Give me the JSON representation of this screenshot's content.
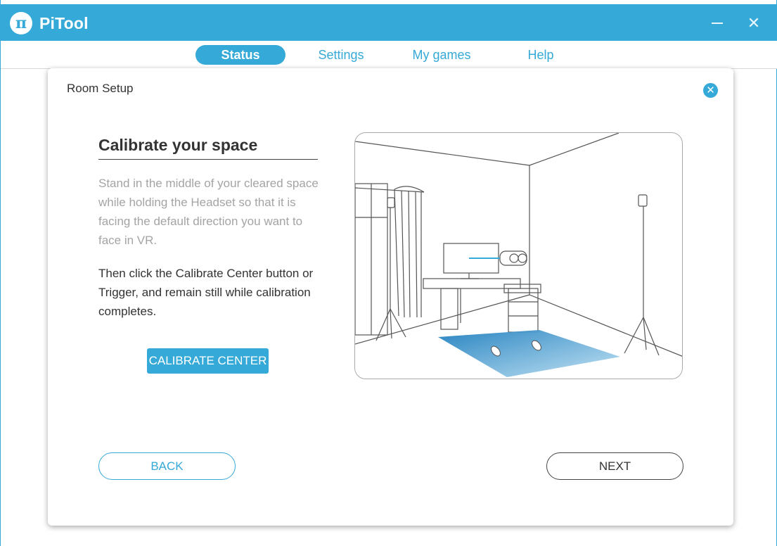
{
  "app": {
    "logo_glyph": "π",
    "title": "PiTool",
    "minimize_icon": "minimize-icon",
    "close_icon": "close-icon",
    "close_glyph": "✕"
  },
  "nav": {
    "tabs": [
      {
        "label": "Status",
        "active": true
      },
      {
        "label": "Settings",
        "active": false
      },
      {
        "label": "My games",
        "active": false
      },
      {
        "label": "Help",
        "active": false
      }
    ]
  },
  "dialog": {
    "title": "Room Setup",
    "close_glyph": "✕",
    "heading": "Calibrate your space",
    "instructions_secondary": "Stand in the middle of your cleared space while holding the Headset so that it is facing the default direction you want to face in VR.",
    "instructions_primary": "Then click the Calibrate Center button or Trigger, and remain still while calibration completes.",
    "calibrate_label": "CALIBRATE CENTER",
    "back_label": "BACK",
    "next_label": "NEXT"
  },
  "colors": {
    "accent": "#35a9d7",
    "text_dark": "#333333",
    "text_muted": "#a4a4a4"
  }
}
